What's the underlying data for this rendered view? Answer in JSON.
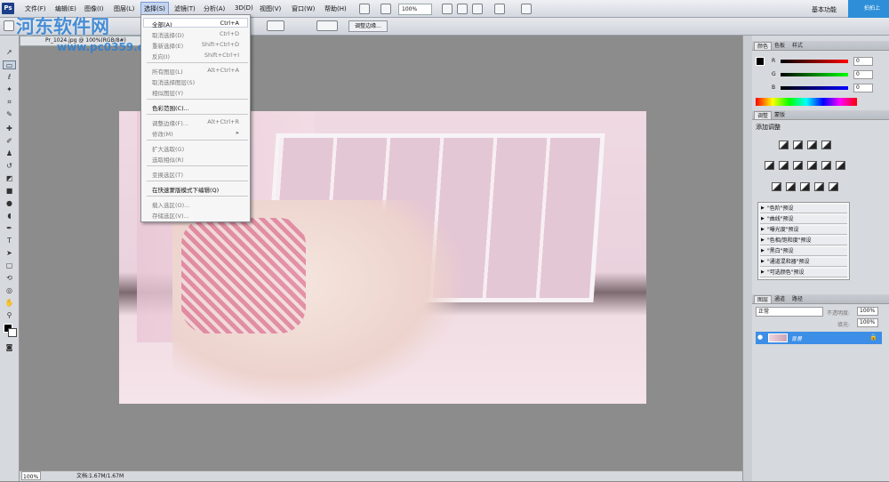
{
  "app": {
    "logo": "Ps"
  },
  "menu": [
    {
      "label": "文件(F)"
    },
    {
      "label": "编辑(E)"
    },
    {
      "label": "图像(I)"
    },
    {
      "label": "图层(L)"
    },
    {
      "label": "选择(S)",
      "active": true
    },
    {
      "label": "滤镜(T)"
    },
    {
      "label": "分析(A)"
    },
    {
      "label": "3D(D)"
    },
    {
      "label": "视图(V)"
    },
    {
      "label": "窗口(W)"
    },
    {
      "label": "帮助(H)"
    }
  ],
  "toolbar": {
    "zoom": "100%",
    "workspace": "基本功能",
    "badge": "拍拍上"
  },
  "options_bar": {
    "adjust_edge": "调整边缘..."
  },
  "document": {
    "tab": "Pr_1024.jpg @ 100%(RGB/8#)"
  },
  "dropdown": {
    "items": [
      {
        "label": "全部(A)",
        "shortcut": "Ctrl+A",
        "enabled": true
      },
      {
        "label": "取消选择(D)",
        "shortcut": "Ctrl+D",
        "enabled": false
      },
      {
        "label": "重新选择(E)",
        "shortcut": "Shift+Ctrl+D",
        "enabled": false
      },
      {
        "label": "反向(I)",
        "shortcut": "Shift+Ctrl+I",
        "enabled": false
      },
      {
        "label": "所有图层(L)",
        "shortcut": "Alt+Ctrl+A",
        "enabled": false
      },
      {
        "label": "取消选择图层(S)",
        "shortcut": "",
        "enabled": false
      },
      {
        "label": "相似图层(Y)",
        "shortcut": "",
        "enabled": false
      },
      {
        "label": "色彩范围(C)...",
        "shortcut": "",
        "enabled": true
      },
      {
        "label": "调整边缘(F)...",
        "shortcut": "Alt+Ctrl+R",
        "enabled": false
      },
      {
        "label": "修改(M)",
        "shortcut": "▸",
        "enabled": false
      },
      {
        "label": "扩大选取(G)",
        "shortcut": "",
        "enabled": false
      },
      {
        "label": "选取相似(R)",
        "shortcut": "",
        "enabled": false
      },
      {
        "label": "变换选区(T)",
        "shortcut": "",
        "enabled": false
      },
      {
        "label": "在快速蒙版模式下编辑(Q)",
        "shortcut": "",
        "enabled": true
      },
      {
        "label": "载入选区(O)...",
        "shortcut": "",
        "enabled": false
      },
      {
        "label": "存储选区(V)...",
        "shortcut": "",
        "enabled": false
      }
    ]
  },
  "color_panel": {
    "tabs": [
      "颜色",
      "色板",
      "样式"
    ],
    "r": {
      "label": "R",
      "value": "0"
    },
    "g": {
      "label": "G",
      "value": "0"
    },
    "b": {
      "label": "B",
      "value": "0"
    }
  },
  "adjust_panel": {
    "tabs": [
      "调整",
      "蒙版"
    ],
    "title": "添加调整",
    "presets": [
      "\"色阶\"预设",
      "\"曲线\"预设",
      "\"曝光度\"预设",
      "\"色相/饱和度\"预设",
      "\"黑白\"预设",
      "\"通道混和器\"预设",
      "\"可选颜色\"预设"
    ]
  },
  "layers_panel": {
    "tabs": [
      "图层",
      "通道",
      "路径"
    ],
    "mode": "正常",
    "opacity_label": "不透明度:",
    "opacity": "100%",
    "fill_label": "填充:",
    "fill": "100%",
    "layer_name": "背景"
  },
  "status": {
    "zoom": "100%",
    "doc": "文档:1.67M/1.67M"
  },
  "watermark": {
    "title": "河东软件网",
    "url": "www.pc0359.cn"
  }
}
